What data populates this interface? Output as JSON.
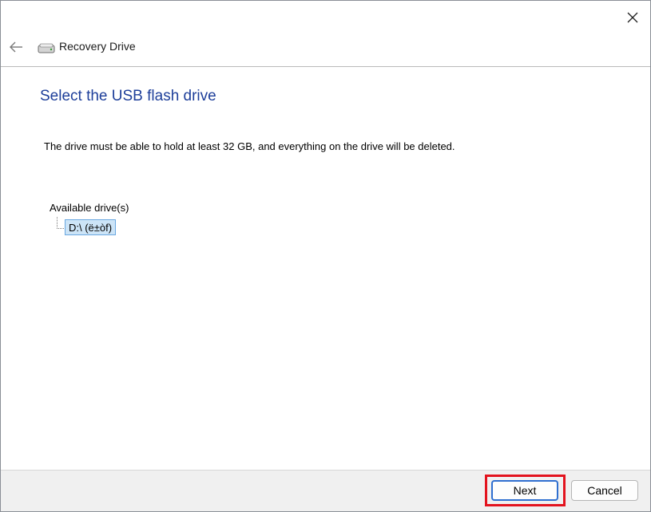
{
  "window": {
    "title": "Recovery Drive",
    "close_icon": "close-icon",
    "back_icon": "back-arrow-icon",
    "app_icon": "drive-icon"
  },
  "content": {
    "heading": "Select the USB flash drive",
    "description": "The drive must be able to hold at least 32 GB, and everything on the drive will be deleted.",
    "tree_header": "Available drive(s)",
    "drives": [
      {
        "label": "D:\\ (ë±òf)",
        "selected": true
      }
    ]
  },
  "footer": {
    "next_label": "Next",
    "cancel_label": "Cancel"
  },
  "colors": {
    "heading": "#1e3f9a",
    "selection_bg": "#cce4f7",
    "highlight": "#e3131e"
  }
}
